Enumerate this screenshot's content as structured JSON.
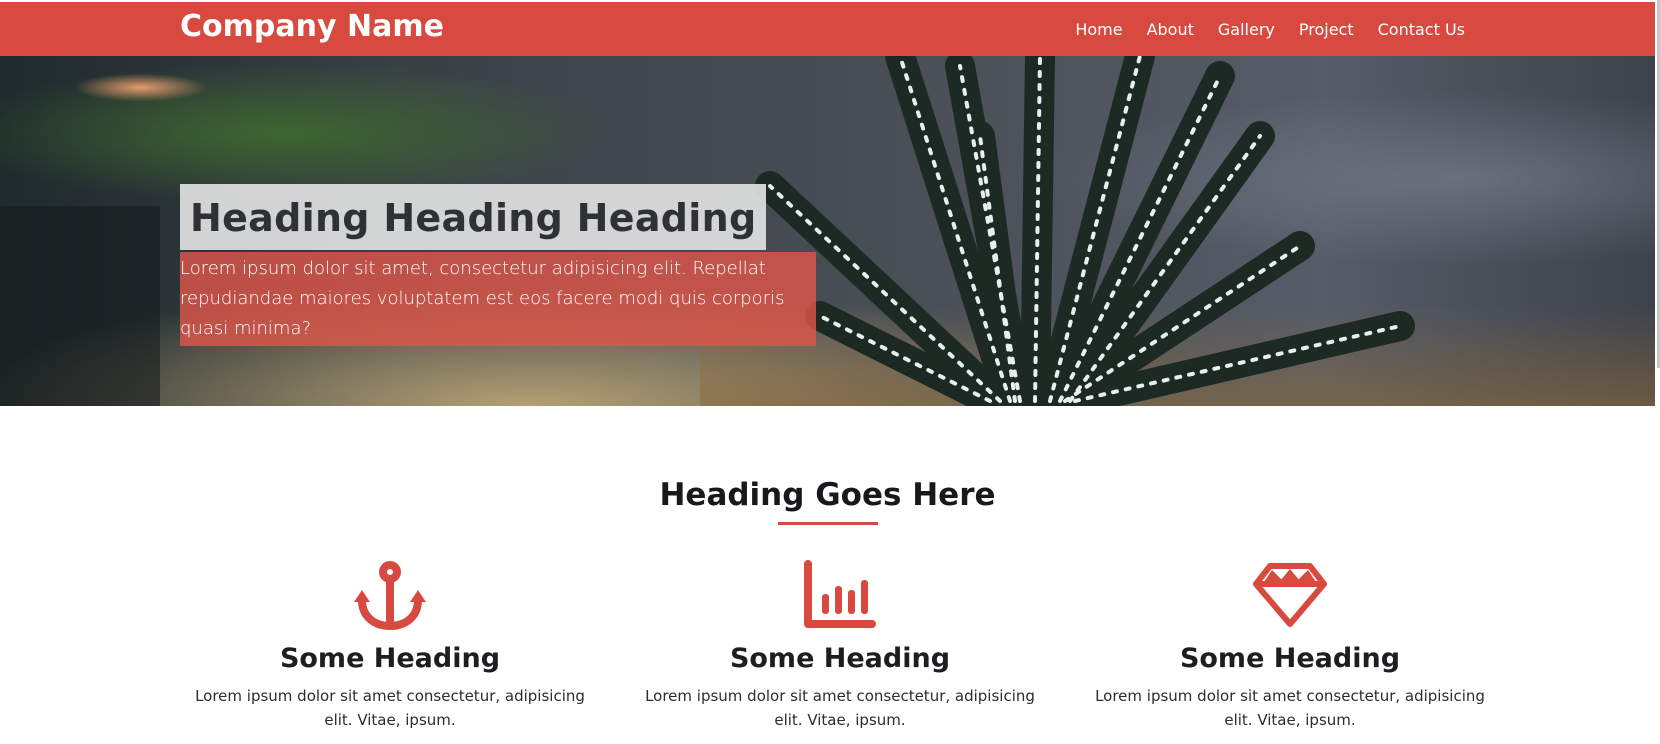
{
  "navbar": {
    "brand": "Company Name",
    "links": [
      "Home",
      "About",
      "Gallery",
      "Project",
      "Contact Us"
    ],
    "background": "#d84a3f"
  },
  "hero": {
    "heading": "Heading Heading Heading",
    "text": "Lorem ipsum dolor sit amet, consectetur adipisicing elit. Repellat repudiandae maiores voluptatem est eos facere modi quis corporis quasi minima?"
  },
  "section": {
    "title": "Heading Goes Here",
    "accent": "#d84a3f",
    "features": [
      {
        "icon": "anchor-icon",
        "heading": "Some Heading",
        "text": "Lorem ipsum dolor sit amet consectetur, adipisicing elit. Vitae, ipsum."
      },
      {
        "icon": "bar-chart-icon",
        "heading": "Some Heading",
        "text": "Lorem ipsum dolor sit amet consectetur, adipisicing elit. Vitae, ipsum."
      },
      {
        "icon": "diamond-icon",
        "heading": "Some Heading",
        "text": "Lorem ipsum dolor sit amet consectetur, adipisicing elit. Vitae, ipsum."
      }
    ]
  }
}
